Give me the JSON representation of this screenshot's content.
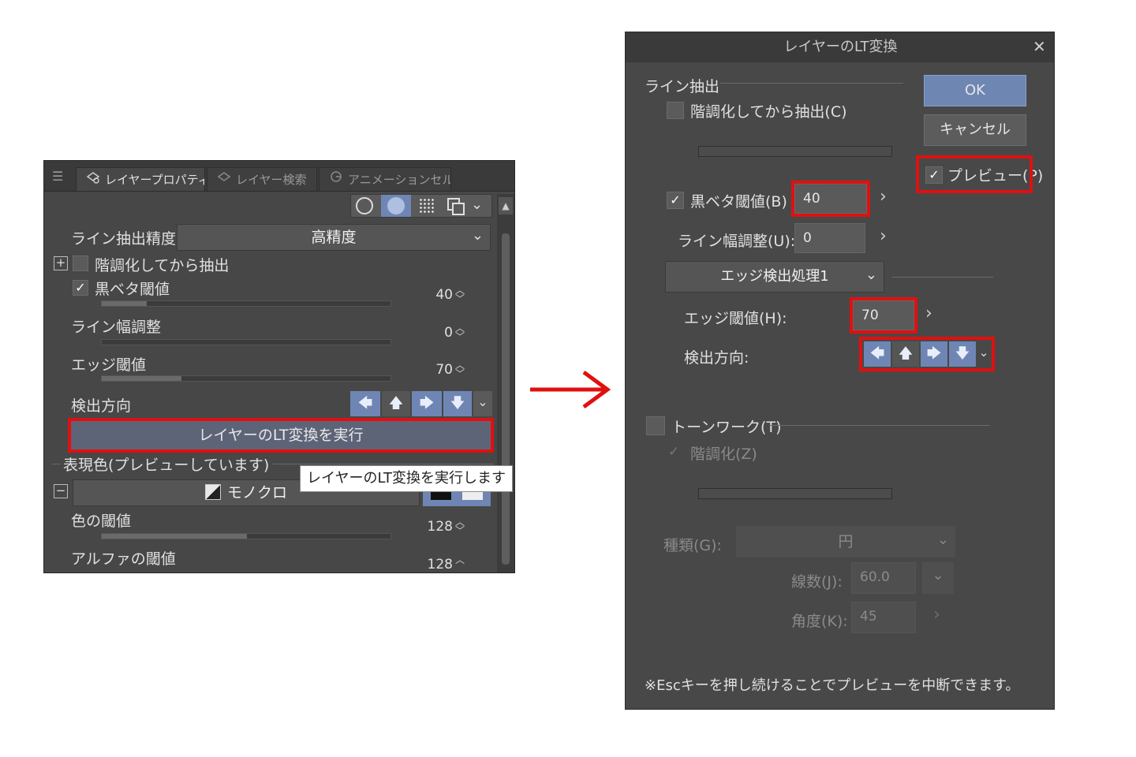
{
  "left_panel": {
    "tabs": {
      "menu": "☰",
      "layer_property": "レイヤープロパティ",
      "layer_search": "レイヤー検索",
      "animation_cel": "アニメーションセル"
    },
    "line_extract_precision": {
      "label": "ライン抽出精度",
      "value": "高精度"
    },
    "gradation_extract": {
      "label": "階調化してから抽出"
    },
    "black_fill_threshold": {
      "label": "黒ベタ閾値",
      "value": "40",
      "checked": "✓"
    },
    "line_width_adjust": {
      "label": "ライン幅調整",
      "value": "0"
    },
    "edge_threshold": {
      "label": "エッジ閾値",
      "value": "70"
    },
    "detect_direction": {
      "label": "検出方向"
    },
    "execute_button": "レイヤーのLT変換を実行",
    "expression_color": {
      "label": "表現色(プレビューしています)",
      "value": "モノクロ"
    },
    "tooltip": "レイヤーのLT変換を実行します",
    "color_threshold": {
      "label": "色の閾値",
      "value": "128"
    },
    "alpha_threshold": {
      "label": "アルファの閾値",
      "value": "128"
    }
  },
  "arrow": "→",
  "dialog": {
    "title": "レイヤーのLT変換",
    "close": "✕",
    "ok": "OK",
    "cancel": "キャンセル",
    "preview": {
      "label": "プレビュー(P)",
      "checked": "✓"
    },
    "line_extract": {
      "section": "ライン抽出",
      "gradation": "階調化してから抽出(C)"
    },
    "black_threshold": {
      "label": "黒ベタ閾値(B)",
      "value": "40",
      "checked": "✓"
    },
    "line_width": {
      "label": "ライン幅調整(U):",
      "value": "0"
    },
    "edge_process": "エッジ検出処理1",
    "edge_threshold": {
      "label": "エッジ閾値(H):",
      "value": "70"
    },
    "detect_direction": {
      "label": "検出方向:"
    },
    "tonework": {
      "label": "トーンワーク(T)",
      "gradation": "階調化(Z)",
      "gradation_checked": "✓"
    },
    "type": {
      "label": "種類(G):",
      "value": "円"
    },
    "lines": {
      "label": "線数(J):",
      "value": "60.0"
    },
    "angle": {
      "label": "角度(K):",
      "value": "45"
    },
    "footer_note": "※Escキーを押し続けることでプレビューを中断できます。"
  },
  "colors": {
    "highlight": "#e01010",
    "accent": "#6f86b4",
    "panel_bg": "#474747"
  },
  "icons": {
    "left": "🡄",
    "up": "🡅",
    "right": "🡆",
    "down": "🡇",
    "chevron": "⌄",
    "gt": "›",
    "spin_up": "︿",
    "spin_down": "﹀"
  }
}
